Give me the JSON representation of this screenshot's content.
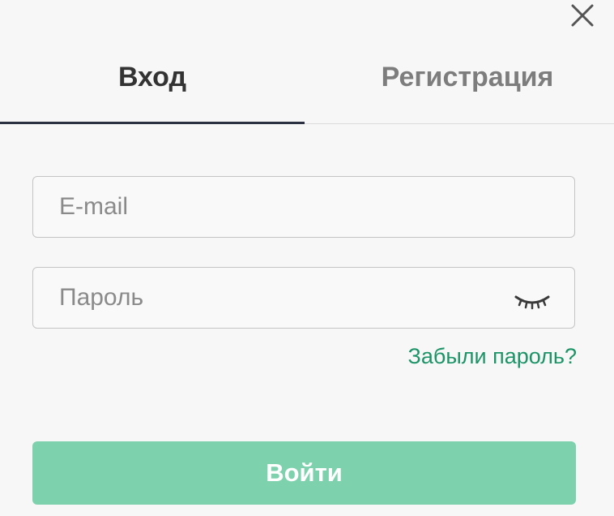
{
  "modal": {
    "close_icon": "close-icon"
  },
  "tabs": [
    {
      "label": "Вход",
      "active": true
    },
    {
      "label": "Регистрация",
      "active": false
    }
  ],
  "form": {
    "email": {
      "placeholder": "E-mail",
      "value": ""
    },
    "password": {
      "placeholder": "Пароль",
      "value": "",
      "toggle_icon": "eye-closed-icon"
    },
    "forgot_label": "Забыли пароль?",
    "submit_label": "Войти"
  },
  "colors": {
    "accent": "#1c9468",
    "button": "#7dd1ac",
    "active_tab_underline": "#2b3140"
  }
}
